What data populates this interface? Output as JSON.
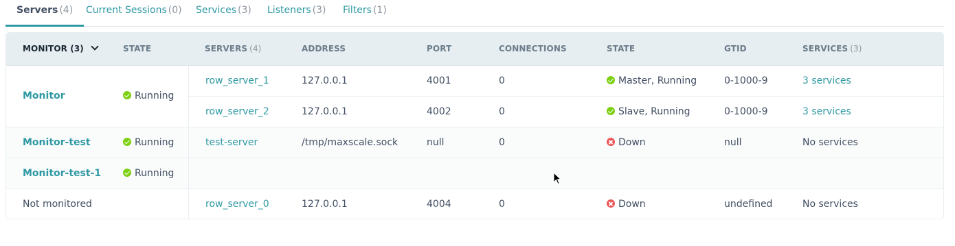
{
  "tabs": [
    {
      "label": "Servers",
      "count": "(4)"
    },
    {
      "label": "Current Sessions",
      "count": "(0)"
    },
    {
      "label": "Services",
      "count": "(3)"
    },
    {
      "label": "Listeners",
      "count": "(3)"
    },
    {
      "label": "Filters",
      "count": "(1)"
    }
  ],
  "table": {
    "headers": {
      "monitor": "MONITOR (3)",
      "monitor_state": "STATE",
      "servers": "SERVERS",
      "servers_count": "(4)",
      "address": "ADDRESS",
      "port": "PORT",
      "connections": "CONNECTIONS",
      "server_state": "STATE",
      "gtid": "GTID",
      "services": "SERVICES",
      "services_count": "(3)"
    },
    "monitors": [
      {
        "name": "Monitor",
        "state": "Running"
      },
      {
        "name": "Monitor-test",
        "state": "Running"
      },
      {
        "name": "Monitor-test-1",
        "state": "Running"
      },
      {
        "name": "Not monitored",
        "state": ""
      }
    ],
    "servers": [
      {
        "name": "row_server_1",
        "address": "127.0.0.1",
        "port": "4001",
        "connections": "0",
        "state": "Master, Running",
        "gtid": "0-1000-9",
        "services": "3 services"
      },
      {
        "name": "row_server_2",
        "address": "127.0.0.1",
        "port": "4002",
        "connections": "0",
        "state": "Slave, Running",
        "gtid": "0-1000-9",
        "services": "3 services"
      },
      {
        "name": "test-server",
        "address": "/tmp/maxscale.sock",
        "port": "null",
        "connections": "0",
        "state": "Down",
        "gtid": "null",
        "services": "No services"
      },
      {
        "name": "row_server_0",
        "address": "127.0.0.1",
        "port": "4004",
        "connections": "0",
        "state": "Down",
        "gtid": "undefined",
        "services": "No services"
      }
    ]
  },
  "colors": {
    "accent": "#2f99a3",
    "ok": "#7dd012",
    "error": "#eb5757",
    "header_bg": "#e7eef1"
  }
}
